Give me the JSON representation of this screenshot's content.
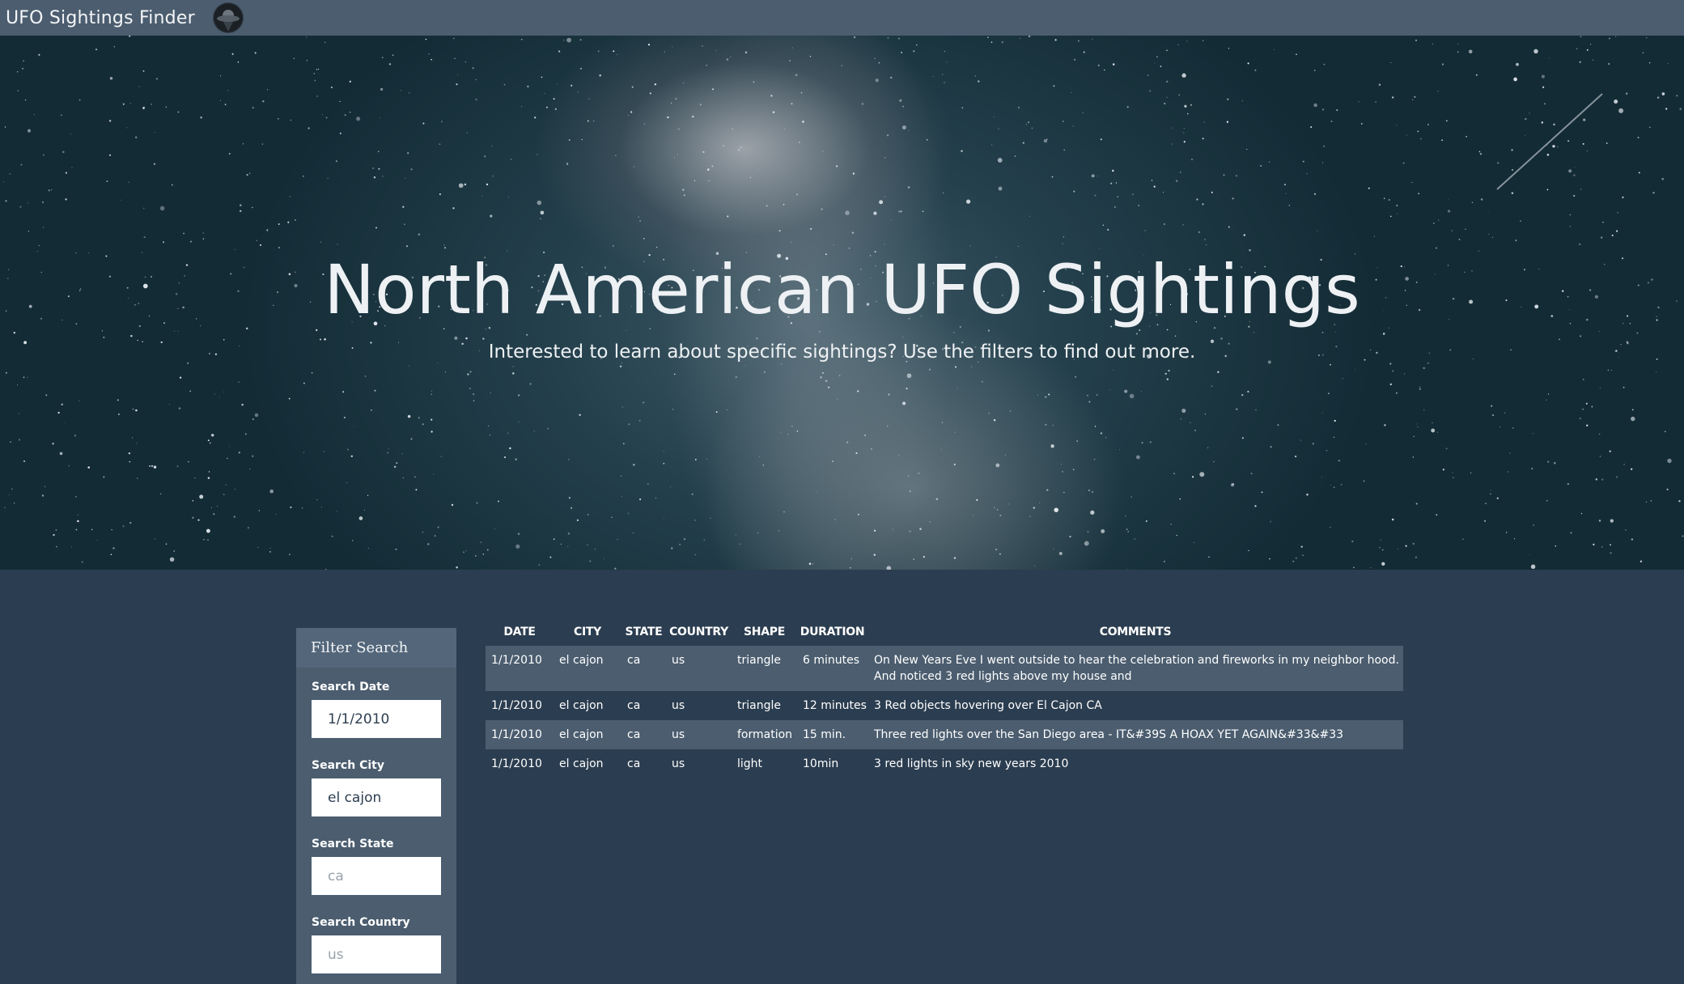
{
  "navbar": {
    "brand": "UFO Sightings Finder",
    "logo_icon": "ufo-logo-icon"
  },
  "hero": {
    "title": "North American UFO Sightings",
    "subtitle": "Interested to learn about specific sightings? Use the filters to find out more."
  },
  "filters": {
    "header": "Filter Search",
    "date": {
      "label": "Search Date",
      "value": "1/1/2010",
      "placeholder": ""
    },
    "city": {
      "label": "Search City",
      "value": "el cajon",
      "placeholder": ""
    },
    "state": {
      "label": "Search State",
      "value": "",
      "placeholder": "ca"
    },
    "country": {
      "label": "Search Country",
      "value": "",
      "placeholder": "us"
    }
  },
  "table": {
    "columns": [
      "Date",
      "City",
      "State",
      "Country",
      "Shape",
      "Duration",
      "Comments"
    ],
    "rows": [
      [
        "1/1/2010",
        "el cajon",
        "ca",
        "us",
        "triangle",
        "6 minutes",
        "On New Years Eve I went outside to hear the celebration and fireworks in my neighbor hood. And noticed 3 red lights above my house and"
      ],
      [
        "1/1/2010",
        "el cajon",
        "ca",
        "us",
        "triangle",
        "12 minutes",
        "3 Red objects hovering over El Cajon CA"
      ],
      [
        "1/1/2010",
        "el cajon",
        "ca",
        "us",
        "formation",
        "15 min.",
        "Three red lights over the San Diego area - IT&#39S A HOAX YET AGAIN&#33&#33"
      ],
      [
        "1/1/2010",
        "el cajon",
        "ca",
        "us",
        "light",
        "10min",
        "3 red lights in sky new years 2010"
      ]
    ]
  },
  "colors": {
    "navbar": "#4b5d6f",
    "page_background": "#2b3d50",
    "panel": "#4b5d6f",
    "striped_row": "#4b5d6f"
  }
}
